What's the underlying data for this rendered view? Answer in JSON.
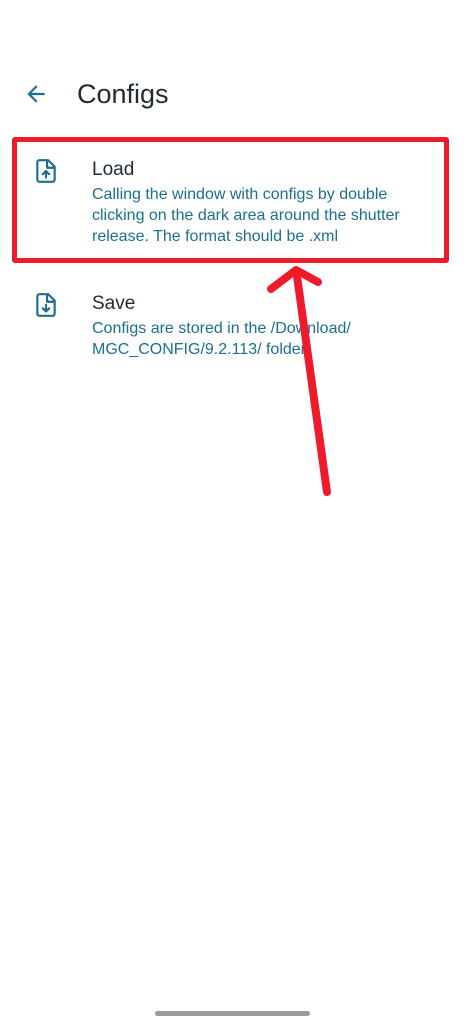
{
  "header": {
    "title": "Configs",
    "back_icon": "arrow-back-icon"
  },
  "items": [
    {
      "title": "Load",
      "subtitle": "Calling the window with configs by double clicking on the dark area around the shutter release. The format should be .xml",
      "icon": "file-upload-icon"
    },
    {
      "title": "Save",
      "subtitle": "Configs are stored in the /Download/ MGC_CONFIG/9.2.113/ folder.",
      "icon": "file-download-icon"
    }
  ],
  "colors": {
    "accent": "#1b6f8f",
    "annotation": "#ef1b2b",
    "text": "#1f2a33"
  }
}
